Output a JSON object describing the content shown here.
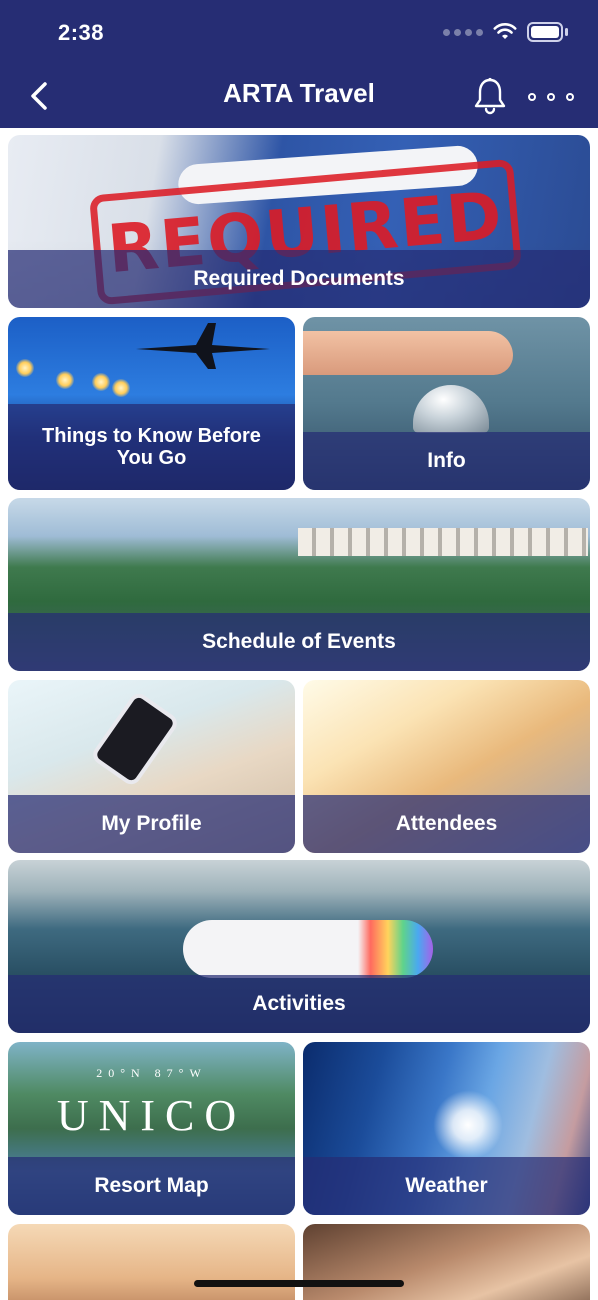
{
  "status_bar": {
    "time": "2:38",
    "signal_icon": "signal-dots-icon",
    "wifi_icon": "wifi-icon",
    "battery_icon": "battery-icon"
  },
  "nav": {
    "title": "ARTA Travel",
    "back_icon": "chevron-left-icon",
    "notification_icon": "bell-icon",
    "more_icon": "more-horizontal-icon"
  },
  "tiles": [
    {
      "label": "Required Documents",
      "stamp_text": "REQUIRED"
    },
    {
      "label": "Things to Know Before You Go"
    },
    {
      "label": "Info"
    },
    {
      "label": "Schedule of Events"
    },
    {
      "label": "My Profile"
    },
    {
      "label": "Attendees"
    },
    {
      "label": "Activities"
    },
    {
      "label": "Resort Map",
      "logo_text": "UNICO",
      "logo_subtext": "20°N 87°W"
    },
    {
      "label": "Weather"
    }
  ],
  "colors": {
    "brand": "#262d74",
    "label_band": "rgba(38,45,116,0.72)",
    "stamp_red": "#dc1c26"
  }
}
